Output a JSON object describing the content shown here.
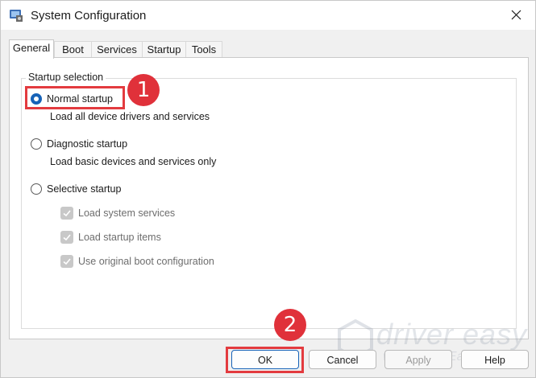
{
  "window": {
    "title": "System Configuration"
  },
  "tabs": [
    {
      "label": "General",
      "active": true
    },
    {
      "label": "Boot"
    },
    {
      "label": "Services"
    },
    {
      "label": "Startup"
    },
    {
      "label": "Tools"
    }
  ],
  "startup_selection": {
    "legend": "Startup selection",
    "options": [
      {
        "label": "Normal startup",
        "description": "Load all device drivers and services",
        "selected": true
      },
      {
        "label": "Diagnostic startup",
        "description": "Load basic devices and services only",
        "selected": false
      },
      {
        "label": "Selective startup",
        "selected": false
      }
    ],
    "selective_items": [
      {
        "label": "Load system services",
        "checked": true,
        "enabled": false
      },
      {
        "label": "Load startup items",
        "checked": true,
        "enabled": false
      },
      {
        "label": "Use original boot configuration",
        "checked": true,
        "enabled": false
      }
    ]
  },
  "annotations": {
    "step1": "1",
    "step2": "2",
    "color": "#e33b3f"
  },
  "buttons": {
    "ok": "OK",
    "cancel": "Cancel",
    "apply": "Apply",
    "help": "Help"
  },
  "watermark": {
    "brand": "driver easy",
    "url": "www.DriverEasy.com"
  }
}
